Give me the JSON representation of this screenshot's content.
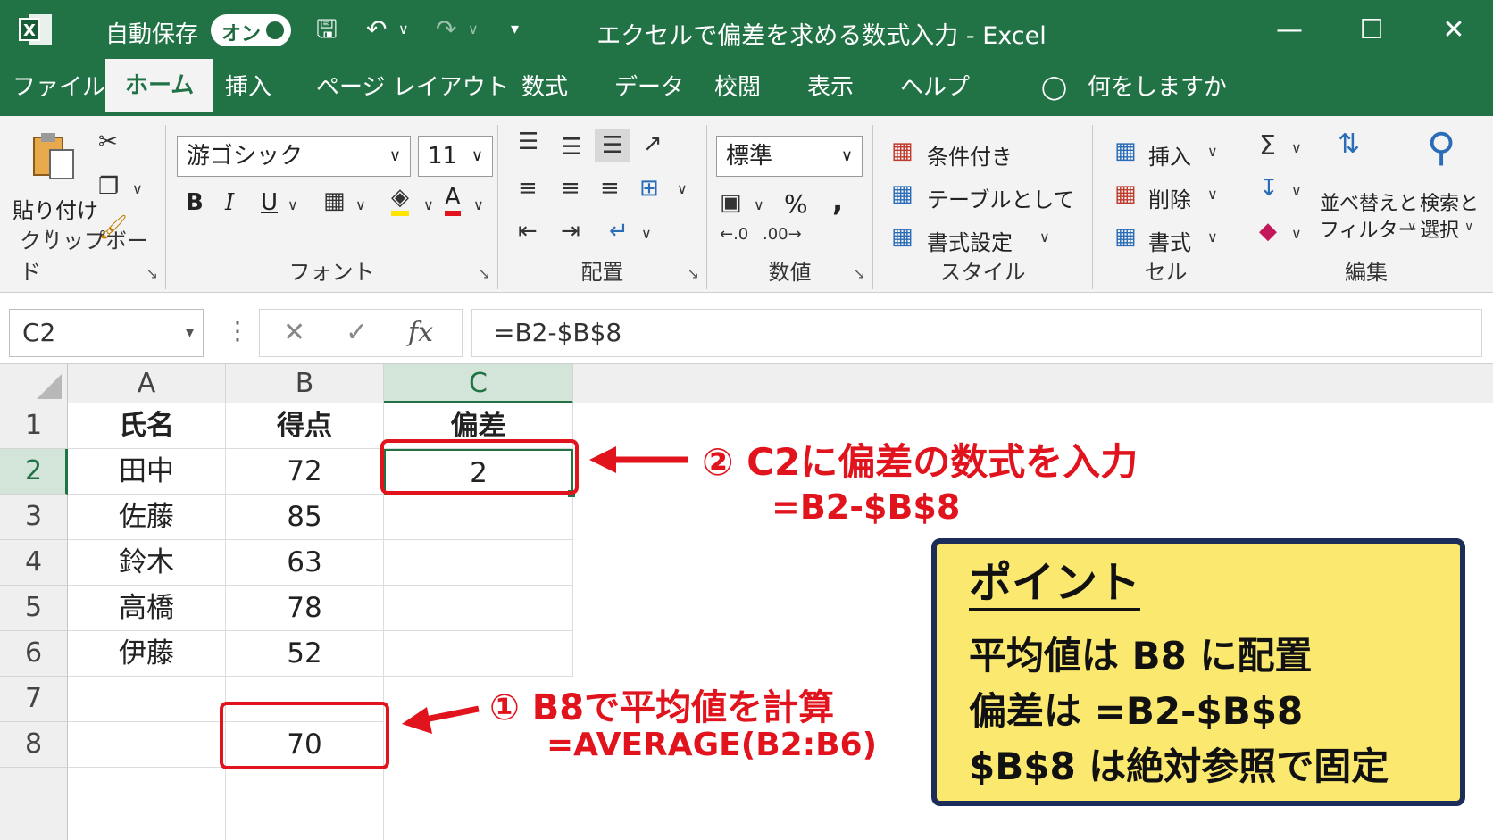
{
  "titlebar": {
    "autosave_label": "自動保存",
    "autosave_state": "オン",
    "title": "エクセルで偏差を求める数式入力  -  Excel"
  },
  "menu": {
    "tabs": [
      "ファイル",
      "ホーム",
      "挿入",
      "ページ レイアウト",
      "数式",
      "データ",
      "校閲",
      "表示",
      "ヘルプ"
    ],
    "active_tab": "ホーム",
    "tell_me": "何をしますか"
  },
  "ribbon": {
    "clipboard": {
      "paste_label": "貼り付け",
      "group_label": "クリップボード"
    },
    "font": {
      "font_name": "游ゴシック",
      "font_size": "11",
      "bold": "B",
      "italic": "I",
      "underline": "U",
      "font_color": "A",
      "group_label": "フォント"
    },
    "alignment": {
      "group_label": "配置"
    },
    "number": {
      "format": "標準",
      "percent": "%",
      "comma": ",",
      "group_label": "数値"
    },
    "styles": {
      "conditional": "条件付き",
      "as_table": "テーブルとして",
      "cell_styles": "書式設定",
      "group_label": "スタイル"
    },
    "cells": {
      "insert": "挿入",
      "delete": "削除",
      "format": "書式",
      "group_label": "セル"
    },
    "editing": {
      "sort_filter_1": "並べ替えと",
      "sort_filter_2": "フィルター",
      "find_select_1": "検索と",
      "find_select_2": "選択",
      "group_label": "編集"
    }
  },
  "formula_bar": {
    "name_box": "C2",
    "fx": "fx",
    "formula": "=B2-$B$8"
  },
  "sheet": {
    "columns": [
      "A",
      "B",
      "C"
    ],
    "rows": [
      "1",
      "2",
      "3",
      "4",
      "5",
      "6",
      "7",
      "8"
    ],
    "headers": {
      "name": "氏名",
      "score": "得点",
      "deviation": "偏差"
    },
    "records": [
      {
        "name": "田中",
        "score": "72",
        "deviation": "2"
      },
      {
        "name": "佐藤",
        "score": "85",
        "deviation": ""
      },
      {
        "name": "鈴木",
        "score": "63",
        "deviation": ""
      },
      {
        "name": "高橋",
        "score": "78",
        "deviation": ""
      },
      {
        "name": "伊藤",
        "score": "52",
        "deviation": ""
      }
    ],
    "average_cell": "70"
  },
  "annotations": {
    "step2_title": "② C2に偏差の数式を入力",
    "step2_formula": "=B2-$B$8",
    "step1_title": "① B8で平均値を計算",
    "step1_formula": "=AVERAGE(B2:B6)"
  },
  "point": {
    "title": "ポイント",
    "line1": "平均値は  B8 に配置",
    "line2": "偏差は =B2-$B$8",
    "line3": "$B$8 は絶対参照で固定"
  },
  "colors": {
    "excel_green": "#217346",
    "annotation_red": "#e1141e",
    "point_yellow": "#fbe96f",
    "point_border": "#1c2d5a"
  }
}
